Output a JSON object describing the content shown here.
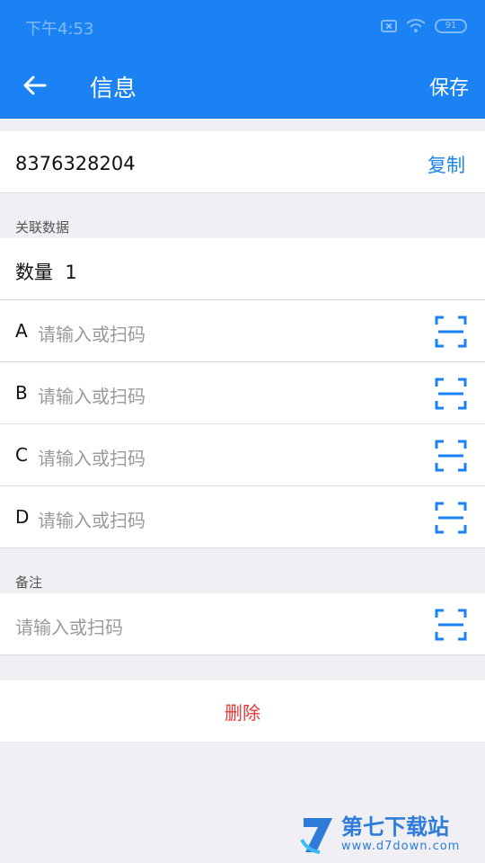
{
  "status": {
    "time": "下午4:53",
    "battery": "91"
  },
  "toolbar": {
    "title": "信息",
    "save_label": "保存"
  },
  "record": {
    "id": "8376328204",
    "copy_label": "复制"
  },
  "related": {
    "section_label": "关联数据",
    "quantity_label": "数量",
    "quantity_value": "1",
    "fields": [
      {
        "label": "A",
        "placeholder": "请输入或扫码"
      },
      {
        "label": "B",
        "placeholder": "请输入或扫码"
      },
      {
        "label": "C",
        "placeholder": "请输入或扫码"
      },
      {
        "label": "D",
        "placeholder": "请输入或扫码"
      }
    ]
  },
  "note": {
    "section_label": "备注",
    "placeholder": "请输入或扫码"
  },
  "actions": {
    "delete_label": "删除"
  },
  "watermark": {
    "title": "第七下载站",
    "url": "www.d7down.com"
  },
  "colors": {
    "primary": "#1a82f2",
    "danger": "#e53935",
    "background": "#efeff4"
  },
  "icons": {
    "back": "arrow-left-icon",
    "scan": "scan-frame-icon"
  }
}
